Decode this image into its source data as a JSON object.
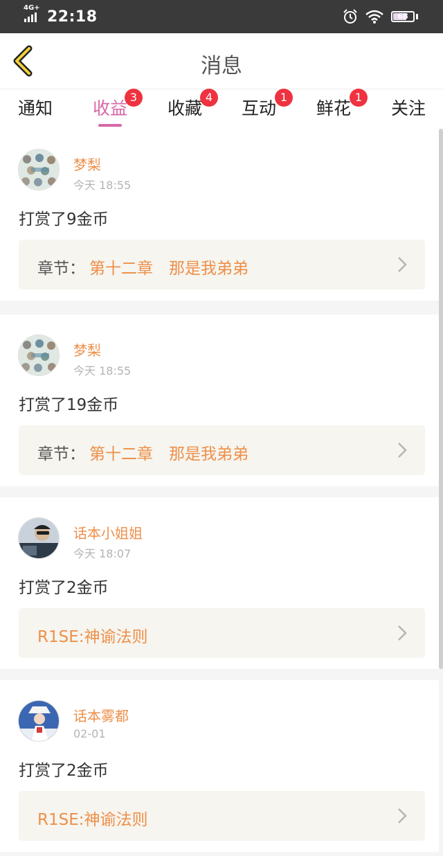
{
  "status_bar": {
    "network": "4G+",
    "time": "22:18",
    "battery": "68",
    "battery_level": 0.68
  },
  "header": {
    "title": "消息"
  },
  "tabs": [
    {
      "label": "通知",
      "badge": ""
    },
    {
      "label": "收益",
      "badge": "3"
    },
    {
      "label": "收藏",
      "badge": "4"
    },
    {
      "label": "互动",
      "badge": "1"
    },
    {
      "label": "鲜花",
      "badge": "1"
    },
    {
      "label": "关注",
      "badge": ""
    }
  ],
  "messages": [
    {
      "user": "梦梨",
      "time": "今天 18:55",
      "text": "打赏了9金币",
      "link_label": "章节：",
      "link_text": "第十二章　那是我弟弟"
    },
    {
      "user": "梦梨",
      "time": "今天 18:55",
      "text": "打赏了19金币",
      "link_label": "章节：",
      "link_text": "第十二章　那是我弟弟"
    },
    {
      "user": "话本小姐姐",
      "time": "今天 18:07",
      "text": "打赏了2金币",
      "link_label": "",
      "link_text": "R1SE:神谕法则"
    },
    {
      "user": "话本雾都",
      "time": "02-01",
      "text": "打赏了2金币",
      "link_label": "",
      "link_text": "R1SE:神谕法则"
    }
  ],
  "colors": {
    "accent": "#d768a6",
    "orange": "#ee8f4a",
    "badge": "#ef3240"
  }
}
